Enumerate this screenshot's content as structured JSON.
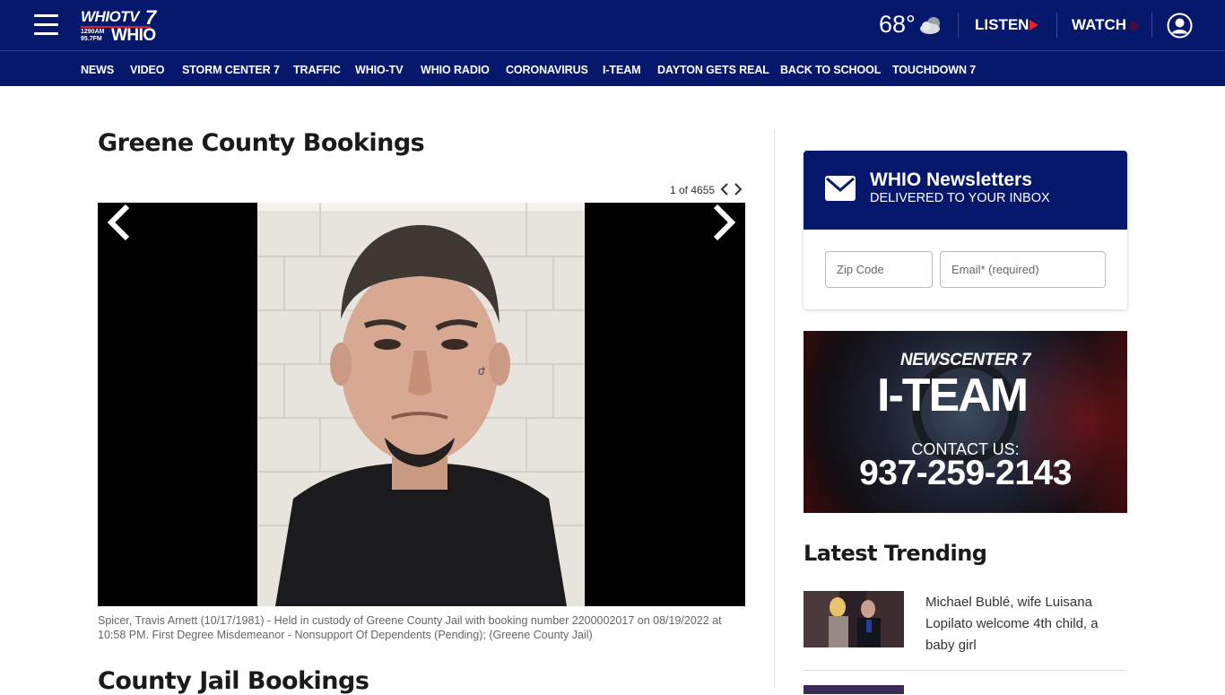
{
  "header": {
    "logo_top": "WHIOTV",
    "logo_seven": "7",
    "logo_freq": "1290AM\n95.7FM",
    "logo_bottom": "WHIO",
    "temperature": "68°",
    "weather_icon": "cloud-icon",
    "listen_label": "LISTEN",
    "watch_label": "WATCH",
    "accent_color": "#e0242d",
    "bg_color": "#06186b"
  },
  "nav": {
    "items": [
      "NEWS",
      "VIDEO",
      "STORM CENTER 7",
      "TRAFFIC",
      "WHIO-TV",
      "WHIO RADIO",
      "CORONAVIRUS",
      "I-TEAM",
      "DAYTON GETS REAL",
      "BACK TO SCHOOL",
      "TOUCHDOWN 7"
    ]
  },
  "main": {
    "title": "Greene County Bookings",
    "counter": "1 of 4655",
    "caption": "Spicer, Travis Arnett (10/17/1981) - Held in custody of Greene County Jail with booking number 2200002017 on 08/19/2022 at 10:58 PM. First Degree Misdemeanor - Nonsupport Of Dependents (Pending); (Greene County Jail)",
    "next_section_title": "County Jail Bookings"
  },
  "newsletter": {
    "title": "WHIO Newsletters",
    "subtitle": "DELIVERED TO YOUR INBOX",
    "zip_placeholder": "Zip Code",
    "email_placeholder": "Email* (required)"
  },
  "ad": {
    "brand": "NEWSCENTER 7",
    "headline": "I-TEAM",
    "contact": "CONTACT US:",
    "phone": "937-259-2143"
  },
  "trending": {
    "title": "Latest Trending",
    "items": [
      {
        "headline": "Michael Bublé, wife Luisana Lopilato welcome 4th child, a baby girl"
      }
    ]
  }
}
